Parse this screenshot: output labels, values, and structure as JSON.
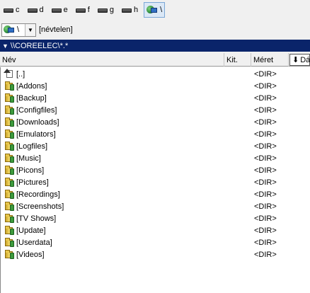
{
  "drives": [
    {
      "label": "c",
      "icon": "hard-drive-icon",
      "active": false
    },
    {
      "label": "d",
      "icon": "hard-drive-icon",
      "active": false
    },
    {
      "label": "e",
      "icon": "hard-drive-icon",
      "active": false
    },
    {
      "label": "f",
      "icon": "hard-drive-icon",
      "active": false
    },
    {
      "label": "g",
      "icon": "hard-drive-icon",
      "active": false
    },
    {
      "label": "h",
      "icon": "hard-drive-icon",
      "active": false
    },
    {
      "label": "\\",
      "icon": "network-icon",
      "active": true
    }
  ],
  "path_combo": {
    "value": "\\",
    "volume_label": "[névtelen]"
  },
  "current_path": "\\\\COREELEC\\*.*",
  "columns": {
    "name": "Név",
    "ext": "Kit.",
    "size": "Méret",
    "date": "Dát"
  },
  "files": [
    {
      "name": "[..]",
      "size": "<DIR>",
      "icon": "parent-dir-icon"
    },
    {
      "name": "[Addons]",
      "size": "<DIR>",
      "icon": "folder-icon"
    },
    {
      "name": "[Backup]",
      "size": "<DIR>",
      "icon": "folder-icon"
    },
    {
      "name": "[Configfiles]",
      "size": "<DIR>",
      "icon": "folder-icon"
    },
    {
      "name": "[Downloads]",
      "size": "<DIR>",
      "icon": "folder-icon"
    },
    {
      "name": "[Emulators]",
      "size": "<DIR>",
      "icon": "folder-icon"
    },
    {
      "name": "[Logfiles]",
      "size": "<DIR>",
      "icon": "folder-icon"
    },
    {
      "name": "[Music]",
      "size": "<DIR>",
      "icon": "folder-icon"
    },
    {
      "name": "[Picons]",
      "size": "<DIR>",
      "icon": "folder-icon"
    },
    {
      "name": "[Pictures]",
      "size": "<DIR>",
      "icon": "folder-icon"
    },
    {
      "name": "[Recordings]",
      "size": "<DIR>",
      "icon": "folder-icon"
    },
    {
      "name": "[Screenshots]",
      "size": "<DIR>",
      "icon": "folder-icon"
    },
    {
      "name": "[TV Shows]",
      "size": "<DIR>",
      "icon": "folder-icon"
    },
    {
      "name": "[Update]",
      "size": "<DIR>",
      "icon": "folder-icon"
    },
    {
      "name": "[Userdata]",
      "size": "<DIR>",
      "icon": "folder-icon"
    },
    {
      "name": "[Videos]",
      "size": "<DIR>",
      "icon": "folder-icon"
    }
  ]
}
